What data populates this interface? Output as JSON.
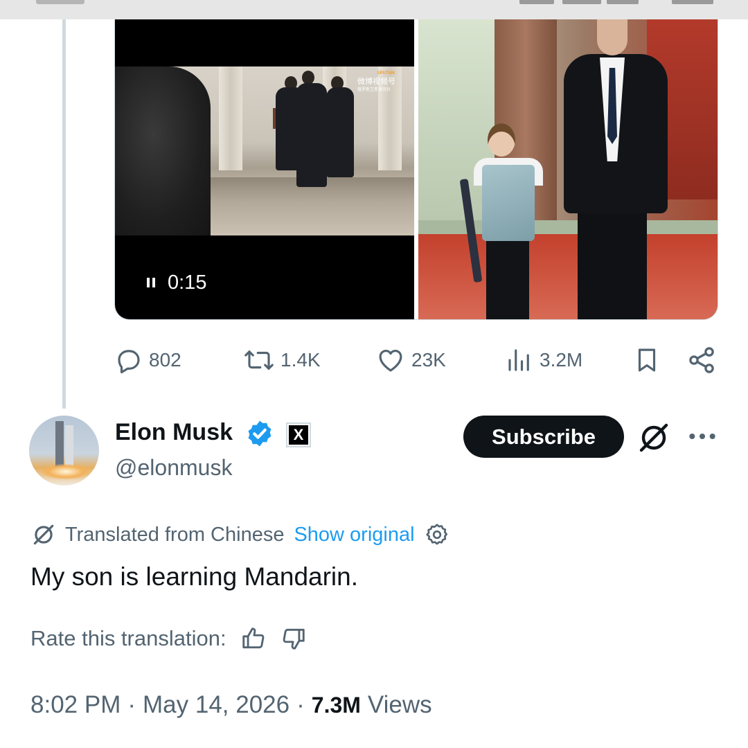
{
  "media": {
    "video_time": "0:15",
    "watermark": {
      "brand": "SPUTNIK",
      "channel": "微博视频号",
      "sub": "俄罗斯卫星通讯社"
    }
  },
  "actions": {
    "replies": "802",
    "reposts": "1.4K",
    "likes": "23K",
    "views": "3.2M"
  },
  "author": {
    "name": "Elon Musk",
    "handle": "@elonmusk",
    "affiliate_badge": "X"
  },
  "header_buttons": {
    "subscribe_label": "Subscribe"
  },
  "translation": {
    "label": "Translated from Chinese",
    "show_original": "Show original"
  },
  "tweet": {
    "text": "My son is learning Mandarin."
  },
  "rating": {
    "label": "Rate this translation:"
  },
  "meta": {
    "time": "8:02 PM",
    "date": "May 14, 2026",
    "separator": "·",
    "views_count": "7.3M",
    "views_label": "Views"
  },
  "colors": {
    "accent": "#1d9bf0",
    "text_primary": "#0f1419",
    "text_secondary": "#536471",
    "border": "#cfd9de"
  }
}
